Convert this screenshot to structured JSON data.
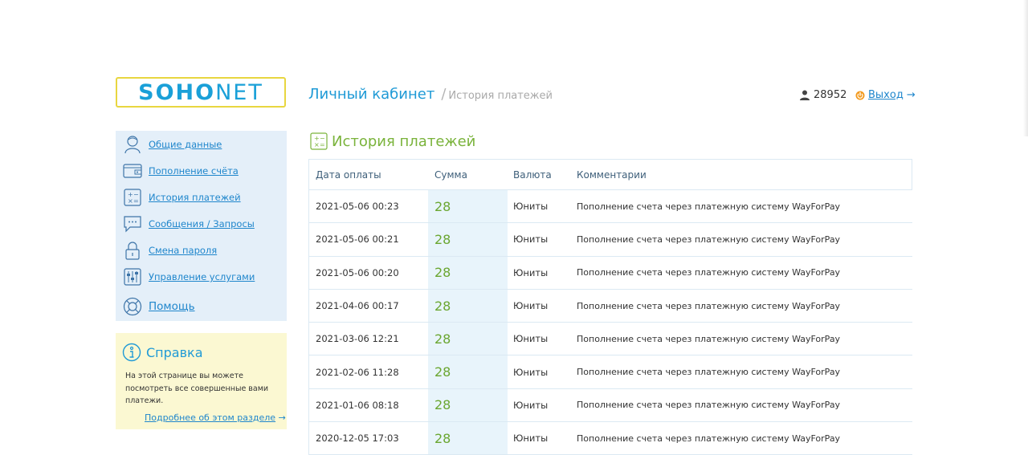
{
  "logo": {
    "part1": "SOHO",
    "part2": "NET"
  },
  "header": {
    "title": "Личный кабинет",
    "separator": "/",
    "subtitle": "История платежей",
    "account_id": "28952",
    "logout_label": "Выход",
    "logout_arrow": "→"
  },
  "sidebar": {
    "items": [
      {
        "label": "Общие данные",
        "icon": "user-icon"
      },
      {
        "label": "Пополнение счёта",
        "icon": "wallet-icon"
      },
      {
        "label": "История платежей",
        "icon": "calculator-icon"
      },
      {
        "label": "Сообщения / Запросы",
        "icon": "chat-icon"
      },
      {
        "label": "Смена пароля",
        "icon": "lock-icon"
      },
      {
        "label": "Управление услугами",
        "icon": "sliders-icon"
      },
      {
        "label": "Помощь",
        "icon": "lifebuoy-icon"
      }
    ]
  },
  "help": {
    "title": "Справка",
    "text": "На этой странице вы можете посмотреть все совершенные вами платежи.",
    "link": "Подробнее об этом разделе",
    "link_arrow": "→"
  },
  "main": {
    "section_title": "История платежей",
    "columns": [
      "Дата оплаты",
      "Сумма",
      "Валюта",
      "Комментарии"
    ],
    "rows": [
      {
        "date": "2021-05-06 00:23",
        "amount": "28",
        "currency": "Юниты",
        "comment": "Пополнение счета через платежную систему WayForPay"
      },
      {
        "date": "2021-05-06 00:21",
        "amount": "28",
        "currency": "Юниты",
        "comment": "Пополнение счета через платежную систему WayForPay"
      },
      {
        "date": "2021-05-06 00:20",
        "amount": "28",
        "currency": "Юниты",
        "comment": "Пополнение счета через платежную систему WayForPay"
      },
      {
        "date": "2021-04-06 00:17",
        "amount": "28",
        "currency": "Юниты",
        "comment": "Пополнение счета через платежную систему WayForPay"
      },
      {
        "date": "2021-03-06 12:21",
        "amount": "28",
        "currency": "Юниты",
        "comment": "Пополнение счета через платежную систему WayForPay"
      },
      {
        "date": "2021-02-06 11:28",
        "amount": "28",
        "currency": "Юниты",
        "comment": "Пополнение счета через платежную систему WayForPay"
      },
      {
        "date": "2021-01-06 08:18",
        "amount": "28",
        "currency": "Юниты",
        "comment": "Пополнение счета через платежную систему WayForPay"
      },
      {
        "date": "2020-12-05 17:03",
        "amount": "28",
        "currency": "Юниты",
        "comment": "Пополнение счета через платежную систему WayForPay"
      }
    ]
  },
  "colors": {
    "accent_blue": "#1f9ad6",
    "link_blue": "#1f86cc",
    "amount_green": "#6aa630",
    "logo_border": "#e8d640",
    "sidebar_bg": "#e4eff9",
    "help_bg": "#fbf8d2"
  }
}
